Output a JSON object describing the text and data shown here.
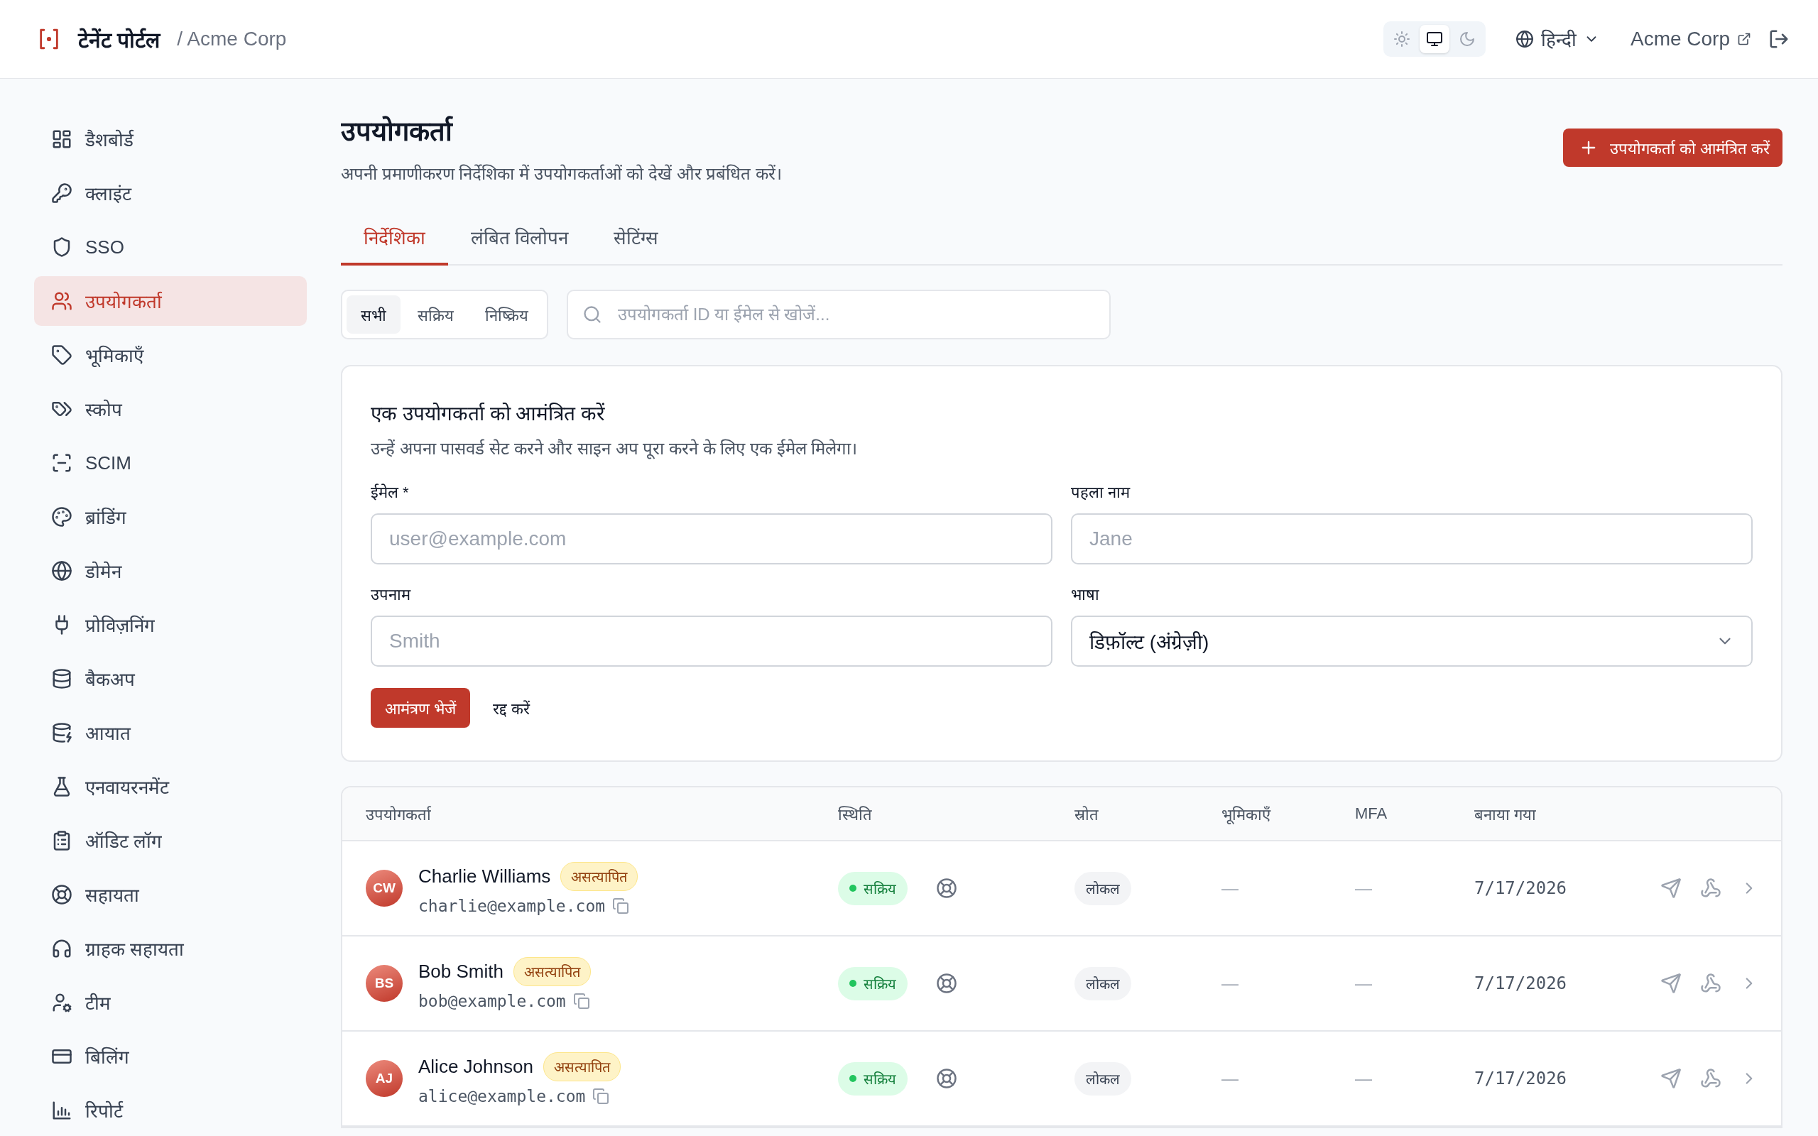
{
  "header": {
    "brand": "टेनेंट पोर्टल",
    "breadcrumb": "/ Acme Corp",
    "theme_options": [
      {
        "kind": "light",
        "selected": false
      },
      {
        "kind": "system",
        "selected": true
      },
      {
        "kind": "dark",
        "selected": false
      }
    ],
    "language": "हिन्दी",
    "org_link": "Acme Corp"
  },
  "sidebar": {
    "items": [
      {
        "label": "डैशबोर्ड",
        "kind": "dashboard",
        "selected": false
      },
      {
        "label": "क्लाइंट",
        "kind": "key",
        "selected": false
      },
      {
        "label": "SSO",
        "kind": "shield",
        "selected": false
      },
      {
        "label": "उपयोगकर्ता",
        "kind": "users",
        "selected": true
      },
      {
        "label": "भूमिकाएँ",
        "kind": "tag",
        "selected": false
      },
      {
        "label": "स्कोप",
        "kind": "tags",
        "selected": false
      },
      {
        "label": "SCIM",
        "kind": "scan",
        "selected": false
      },
      {
        "label": "ब्रांडिंग",
        "kind": "palette",
        "selected": false
      },
      {
        "label": "डोमेन",
        "kind": "globe",
        "selected": false
      },
      {
        "label": "प्रोविज़निंग",
        "kind": "plug",
        "selected": false
      },
      {
        "label": "बैकअप",
        "kind": "database",
        "selected": false
      },
      {
        "label": "आयात",
        "kind": "database-zap",
        "selected": false
      },
      {
        "label": "एनवायरनमेंट",
        "kind": "flask",
        "selected": false
      },
      {
        "label": "ऑडिट लॉग",
        "kind": "clipboard",
        "selected": false
      },
      {
        "label": "सहायता",
        "kind": "lifebuoy",
        "selected": false
      },
      {
        "label": "ग्राहक सहायता",
        "kind": "headphones",
        "selected": false
      },
      {
        "label": "टीम",
        "kind": "user-cog",
        "selected": false
      },
      {
        "label": "बिलिंग",
        "kind": "card",
        "selected": false
      },
      {
        "label": "रिपोर्ट",
        "kind": "chart",
        "selected": false
      }
    ]
  },
  "page": {
    "title": "उपयोगकर्ता",
    "subtitle": "अपनी प्रमाणीकरण निर्देशिका में उपयोगकर्ताओं को देखें और प्रबंधित करें।",
    "invite_button": "उपयोगकर्ता को आमंत्रित करें"
  },
  "tabs": [
    {
      "label": "निर्देशिका",
      "selected": true
    },
    {
      "label": "लंबित विलोपन",
      "selected": false
    },
    {
      "label": "सेटिंग्स",
      "selected": false
    }
  ],
  "filters": [
    {
      "label": "सभी",
      "selected": true
    },
    {
      "label": "सक्रिय",
      "selected": false
    },
    {
      "label": "निष्क्रिय",
      "selected": false
    }
  ],
  "search": {
    "placeholder": "उपयोगकर्ता ID या ईमेल से खोजें..."
  },
  "invite_form": {
    "title": "एक उपयोगकर्ता को आमंत्रित करें",
    "description": "उन्हें अपना पासवर्ड सेट करने और साइन अप पूरा करने के लिए एक ईमेल मिलेगा।",
    "fields": [
      {
        "label": "ईमेल *",
        "kind": "text",
        "placeholder": "user@example.com"
      },
      {
        "label": "पहला नाम",
        "kind": "text",
        "placeholder": "Jane"
      },
      {
        "label": "उपनाम",
        "kind": "text",
        "placeholder": "Smith"
      },
      {
        "label": "भाषा",
        "kind": "select",
        "value": "डिफ़ॉल्ट (अंग्रेज़ी)"
      }
    ],
    "submit": "आमंत्रण भेजें",
    "cancel": "रद्द करें"
  },
  "table": {
    "columns": [
      "उपयोगकर्ता",
      "स्थिति",
      "स्रोत",
      "भूमिकाएँ",
      "MFA",
      "बनाया गया"
    ],
    "rows": [
      {
        "initials": "CW",
        "name": "Charlie Williams",
        "badge": "असत्यापित",
        "email": "charlie@example.com",
        "status": "सक्रिय",
        "source": "लोकल",
        "roles": "—",
        "mfa": "—",
        "created": "7/17/2026"
      },
      {
        "initials": "BS",
        "name": "Bob Smith",
        "badge": "असत्यापित",
        "email": "bob@example.com",
        "status": "सक्रिय",
        "source": "लोकल",
        "roles": "—",
        "mfa": "—",
        "created": "7/17/2026"
      },
      {
        "initials": "AJ",
        "name": "Alice Johnson",
        "badge": "असत्यापित",
        "email": "alice@example.com",
        "status": "सक्रिय",
        "source": "लोकल",
        "roles": "—",
        "mfa": "—",
        "created": "7/17/2026"
      }
    ]
  }
}
